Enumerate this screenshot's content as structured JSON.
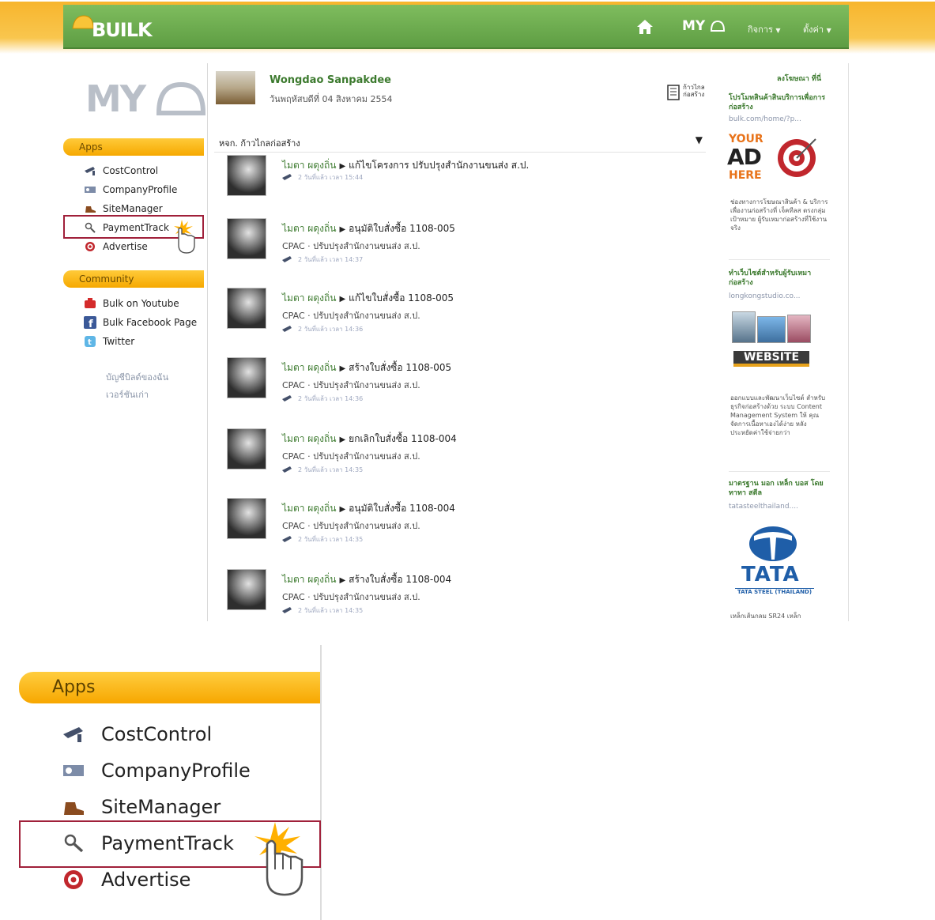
{
  "header": {
    "brand": "BUILK",
    "nav_my": "MY",
    "menu1": "กิจการ",
    "menu2": "ตั้งค่า"
  },
  "sidebar": {
    "logo": "MY",
    "apps_title": "Apps",
    "apps": [
      "CostControl",
      "CompanyProfile",
      "SiteManager",
      "PaymentTrack",
      "Advertise"
    ],
    "community_title": "Community",
    "community": [
      "Bulk on Youtube",
      "Bulk Facebook Page",
      "Twitter"
    ],
    "links": [
      "บัญชีบิลด์ของฉัน",
      "เวอร์ชันเก่า"
    ]
  },
  "profile": {
    "name": "Wongdao Sanpakdee",
    "date": "วันพฤหัสบดีที่ 04 สิงหาคม 2554",
    "org_logo": "ก้าวไกล ก่อสร้าง"
  },
  "feed": {
    "filter": "หจก. ก้าวไกลก่อสร้าง",
    "posts": [
      {
        "author": "ไมตา ผดุงถิ่น",
        "action": "แก้ไขโครงการ ปรับปรุงสำนักงานขนส่ง ส.ป.",
        "sub": "",
        "time": "2 วันที่แล้ว เวลา 15:44"
      },
      {
        "author": "ไมตา ผดุงถิ่น",
        "action": "อนุมัติใบสั่งซื้อ 1108-005",
        "sub": "CPAC · ปรับปรุงสำนักงานขนส่ง ส.ป.",
        "time": "2 วันที่แล้ว เวลา 14:37"
      },
      {
        "author": "ไมตา ผดุงถิ่น",
        "action": "แก้ไขใบสั่งซื้อ 1108-005",
        "sub": "CPAC · ปรับปรุงสำนักงานขนส่ง ส.ป.",
        "time": "2 วันที่แล้ว เวลา 14:36"
      },
      {
        "author": "ไมตา ผดุงถิ่น",
        "action": "สร้างใบสั่งซื้อ 1108-005",
        "sub": "CPAC · ปรับปรุงสำนักงานขนส่ง ส.ป.",
        "time": "2 วันที่แล้ว เวลา 14:36"
      },
      {
        "author": "ไมตา ผดุงถิ่น",
        "action": "ยกเลิกใบสั่งซื้อ 1108-004",
        "sub": "CPAC · ปรับปรุงสำนักงานขนส่ง ส.ป.",
        "time": "2 วันที่แล้ว เวลา 14:35"
      },
      {
        "author": "ไมตา ผดุงถิ่น",
        "action": "อนุมัติใบสั่งซื้อ 1108-004",
        "sub": "CPAC · ปรับปรุงสำนักงานขนส่ง ส.ป.",
        "time": "2 วันที่แล้ว เวลา 14:35"
      },
      {
        "author": "ไมตา ผดุงถิ่น",
        "action": "สร้างใบสั่งซื้อ 1108-004",
        "sub": "CPAC · ปรับปรุงสำนักงานขนส่ง ส.ป.",
        "time": "2 วันที่แล้ว เวลา 14:35"
      }
    ]
  },
  "ads": {
    "header": "ลงโฆษณา ที่นี่",
    "items": [
      {
        "title": "โปรโมทสินค้าสินบริการเพื่อการก่อสร้าง",
        "url": "bulk.com/home/?p...",
        "text": "ช่องทางการโฆษณาสินค้า & บริการ เพื่องานก่อสร้างที่ เจ็คทีลส ตรงกลุ่มเป้าหมาย ผู้รับเหมาก่อสร้างที่ใช้งานจริง"
      },
      {
        "title": "ทำเว็บไซต์สำหรับผู้รับเหมาก่อสร้าง",
        "url": "longkongstudio.co...",
        "text": "ออกแบบและพัฒนาเว็บไซต์ สำหรับธุรกิจก่อสร้างด้วย ระบบ Content Management System ให้ คุณจัดการเนื้อหาเองได้ง่าย หลัง ประหยัดค่าใช้จ่ายกว่า"
      },
      {
        "title": "มาตรฐาน มอก เหล็ก บอส โดย ทาทา สตีล",
        "url": "tatasteelthailand....",
        "text": "เหล็กเส้นกลม SR24 เหล็ก"
      }
    ],
    "ad_badge": [
      "YOUR",
      "AD",
      "HERE"
    ],
    "website_badge": "WEBSITE",
    "tata": "TATA",
    "tata_sub": "TATA STEEL (THAILAND)"
  },
  "zoom": {
    "apps_title": "Apps",
    "apps": [
      "CostControl",
      "CompanyProfile",
      "SiteManager",
      "PaymentTrack",
      "Advertise"
    ]
  },
  "colors": {
    "green": "#5e9d43",
    "orange": "#f6a800",
    "highlight": "#a0203a"
  }
}
